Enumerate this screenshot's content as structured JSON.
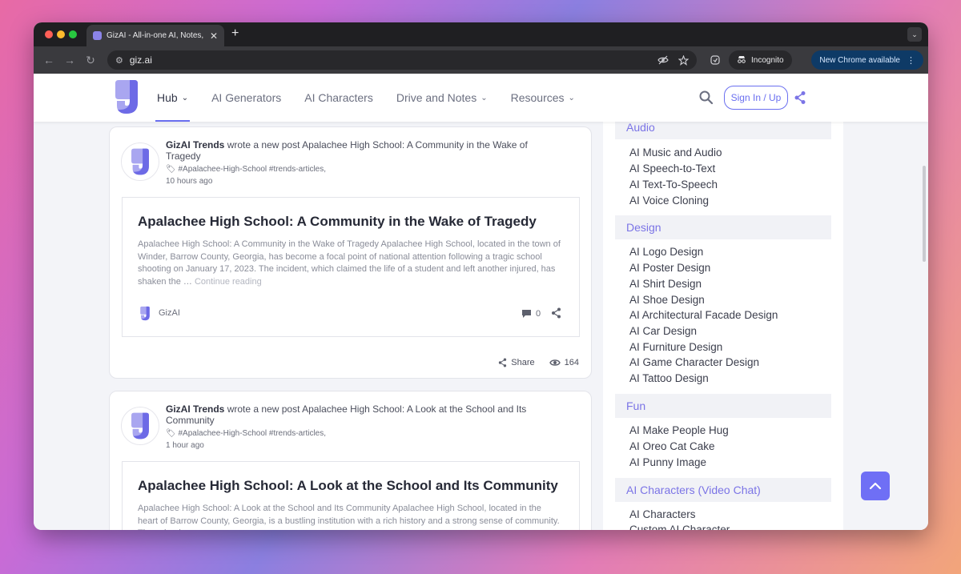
{
  "browser": {
    "tab_title": "GizAI - All-in-one AI, Notes, &",
    "tab_close": "✕",
    "new_tab": "+",
    "tab_menu": "⌄",
    "back": "←",
    "forward": "→",
    "reload": "↻",
    "site_icon": "⚙",
    "url": "giz.ai",
    "incognito_label": "Incognito",
    "new_chrome_label": "New Chrome available",
    "menu_dots": "⋮"
  },
  "nav": {
    "items": [
      {
        "label": "Hub",
        "caret": "⌄",
        "active": true
      },
      {
        "label": "AI Generators",
        "caret": ""
      },
      {
        "label": "AI Characters",
        "caret": ""
      },
      {
        "label": "Drive and Notes",
        "caret": "⌄"
      },
      {
        "label": "Resources",
        "caret": "⌄"
      }
    ],
    "sign_in_label": "Sign In / Up"
  },
  "posts": [
    {
      "author": "GizAI Trends",
      "action": "wrote a new post Apalachee High School: A Community in the Wake of Tragedy",
      "tags": "#Apalachee-High-School #trends-articles,",
      "time": "10 hours ago",
      "title": "Apalachee High School: A Community in the Wake of Tragedy",
      "excerpt": "Apalachee High School: A Community in the Wake of Tragedy Apalachee High School, located in the town of Winder, Barrow County, Georgia, has become a focal point of national attention following a tragic school shooting on January 17, 2023. The incident, which claimed the life of a student and left another injured, has shaken the …",
      "continue_label": "Continue reading",
      "footer_author": "GizAI",
      "comments": "0",
      "share_label": "Share",
      "views": "164"
    },
    {
      "author": "GizAI Trends",
      "action": "wrote a new post Apalachee High School: A Look at the School and Its Community",
      "tags": "#Apalachee-High-School #trends-articles,",
      "time": "1 hour ago",
      "title": "Apalachee High School: A Look at the School and Its Community",
      "excerpt": "Apalachee High School: A Look at the School and Its Community Apalachee High School, located in the heart of Barrow County, Georgia, is a bustling institution with a rich history and a strong sense of community. The school"
    }
  ],
  "sidebar": {
    "categories": [
      {
        "name": "Audio",
        "items": [
          "AI Music and Audio",
          "AI Speech-to-Text",
          "AI Text-To-Speech",
          "AI Voice Cloning"
        ]
      },
      {
        "name": "Design",
        "items": [
          "AI Logo Design",
          "AI Poster Design",
          "AI Shirt Design",
          "AI Shoe Design",
          "AI Architectural Facade Design",
          "AI Car Design",
          "AI Furniture Design",
          "AI Game Character Design",
          "AI Tattoo Design"
        ]
      },
      {
        "name": "Fun",
        "items": [
          "AI Make People Hug",
          "AI Oreo Cat Cake",
          "AI Punny Image"
        ]
      },
      {
        "name": "AI Characters (Video Chat)",
        "items": [
          "AI Characters",
          "Custom AI Character"
        ]
      }
    ]
  },
  "colors": {
    "accent": "#6a6ff0",
    "category_text": "#7b74e6",
    "brand_light": "#a9a6f0",
    "brand_dark": "#6d6ae6"
  }
}
